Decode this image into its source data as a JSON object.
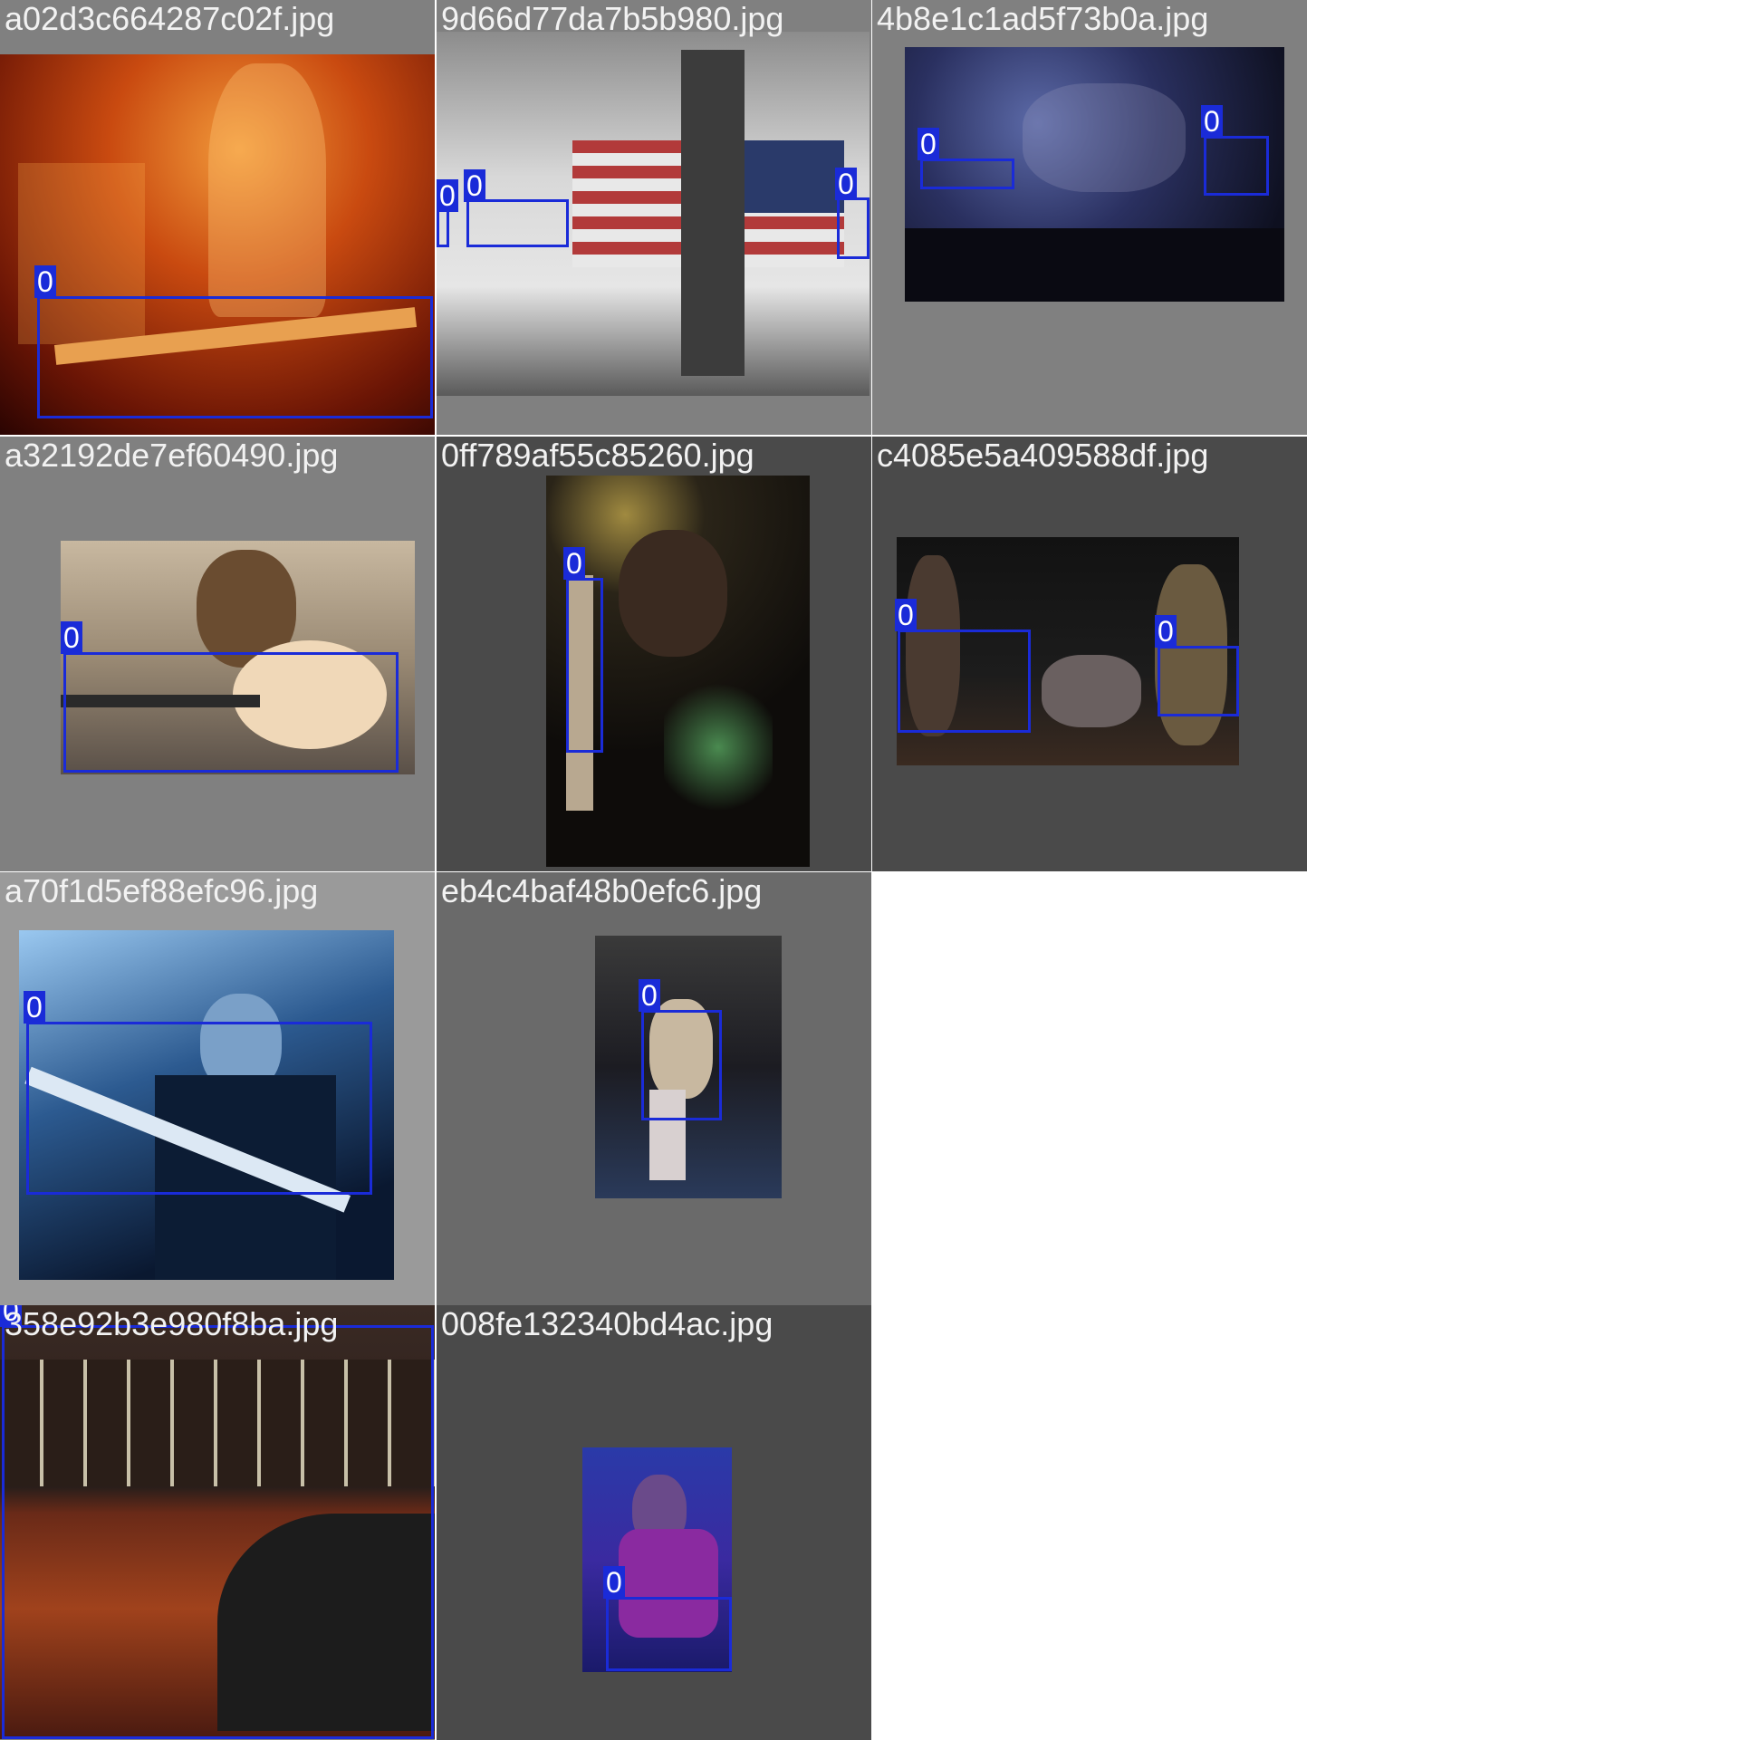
{
  "tiles": [
    {
      "filename": "a02d3c664287c02f.jpg",
      "label": "0"
    },
    {
      "filename": "9d66d77da7b5b980.jpg",
      "label": "0"
    },
    {
      "filename": "4b8e1c1ad5f73b0a.jpg",
      "label": "0"
    },
    {
      "filename": "a32192de7ef60490.jpg",
      "label": "0"
    },
    {
      "filename": "0ff789af55c85260.jpg",
      "label": "0"
    },
    {
      "filename": "c4085e5a409588df.jpg",
      "label": "0"
    },
    {
      "filename": "a70f1d5ef88efc96.jpg",
      "label": "0"
    },
    {
      "filename": "eb4c4baf48b0efc6.jpg",
      "label": "0"
    },
    {
      "filename": "358e92b3e980f8ba.jpg",
      "label": "0"
    },
    {
      "filename": "008fe132340bd4ac.jpg",
      "label": "0"
    }
  ],
  "colors": {
    "box": "#1a2bd8"
  }
}
